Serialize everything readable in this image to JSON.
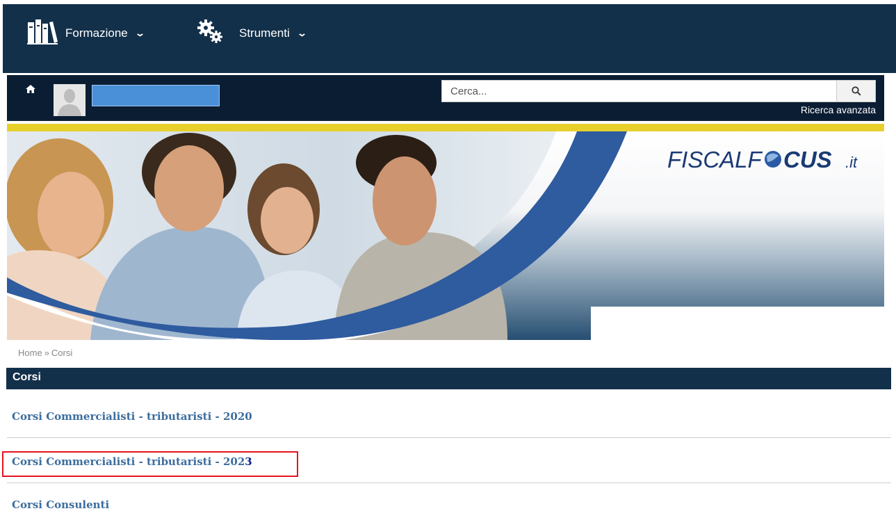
{
  "topnav": {
    "items": [
      {
        "label": "Formazione",
        "icon": "books-icon"
      },
      {
        "label": "Strumenti",
        "icon": "gears-icon"
      }
    ]
  },
  "userbar": {
    "search_placeholder": "Cerca...",
    "advanced_search": "Ricerca avanzata"
  },
  "banner": {
    "brand_part1": "FISCALF",
    "brand_part2": "CUS",
    "brand_suffix": ".it"
  },
  "breadcrumb": {
    "home": "Home",
    "separator": "»",
    "current": "Corsi"
  },
  "section": {
    "title": "Corsi"
  },
  "courses": [
    {
      "label": "Corsi Commercialisti - tributaristi - 2020"
    },
    {
      "label": "Corsi Commercialisti - tributaristi - 202",
      "suffix": "3"
    },
    {
      "label": "Corsi Consulenti"
    }
  ],
  "colors": {
    "nav_bg": "#13304a",
    "userbar_bg": "#0b1d33",
    "accent_yellow": "#e7d02c",
    "link": "#3c6d9e",
    "highlight_border": "#e5141e"
  }
}
